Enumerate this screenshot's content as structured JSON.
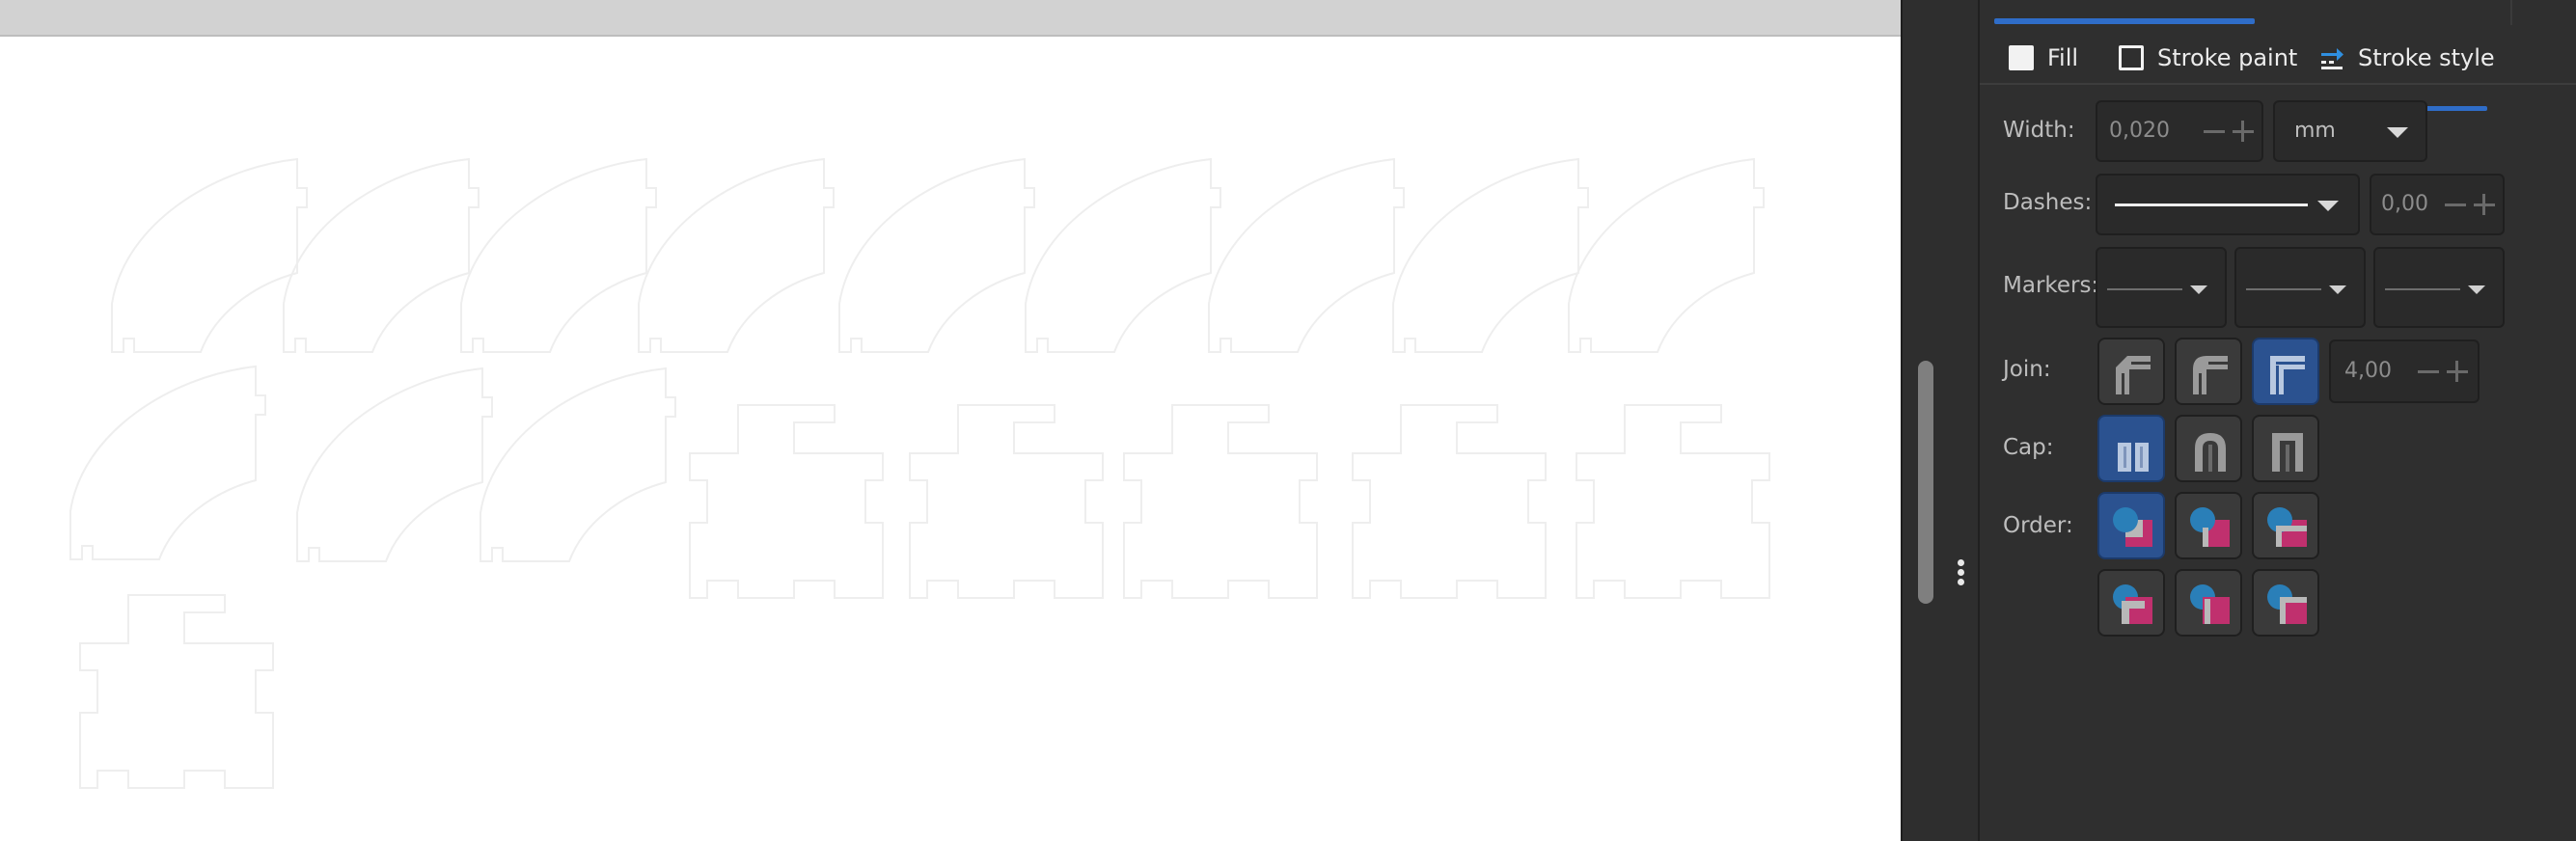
{
  "panel": {
    "tabs": [
      {
        "label": "Fill",
        "icon": "fill-swatch-icon"
      },
      {
        "label": "Stroke paint",
        "icon": "stroke-paint-swatch-icon"
      },
      {
        "label": "Stroke style",
        "icon": "stroke-style-icon",
        "active": true
      }
    ],
    "width": {
      "label": "Width:",
      "value": "0,020",
      "unit": "mm"
    },
    "dashes": {
      "label": "Dashes:",
      "offset": "0,00"
    },
    "markers": {
      "label": "Markers:"
    },
    "join": {
      "label": "Join:",
      "options": [
        "bevel-join-icon",
        "round-join-icon",
        "miter-join-icon"
      ],
      "selected": "miter-join-icon",
      "miter_limit": "4,00"
    },
    "cap": {
      "label": "Cap:",
      "options": [
        "butt-cap-icon",
        "round-cap-icon",
        "square-cap-icon"
      ],
      "selected": "butt-cap-icon"
    },
    "order": {
      "label": "Order:",
      "options": [
        "fill-stroke-markers-icon",
        "stroke-fill-markers-icon",
        "fill-markers-stroke-icon",
        "markers-fill-stroke-icon",
        "stroke-markers-fill-icon",
        "markers-stroke-fill-icon"
      ],
      "selected": "fill-stroke-markers-icon"
    }
  },
  "colors": {
    "accent": "#2f6dc8",
    "panel_bg": "#2f2f2f",
    "canvas_bg": "#ffffff",
    "order_circle": "#2a7fb8",
    "order_square": "#c0306e"
  }
}
